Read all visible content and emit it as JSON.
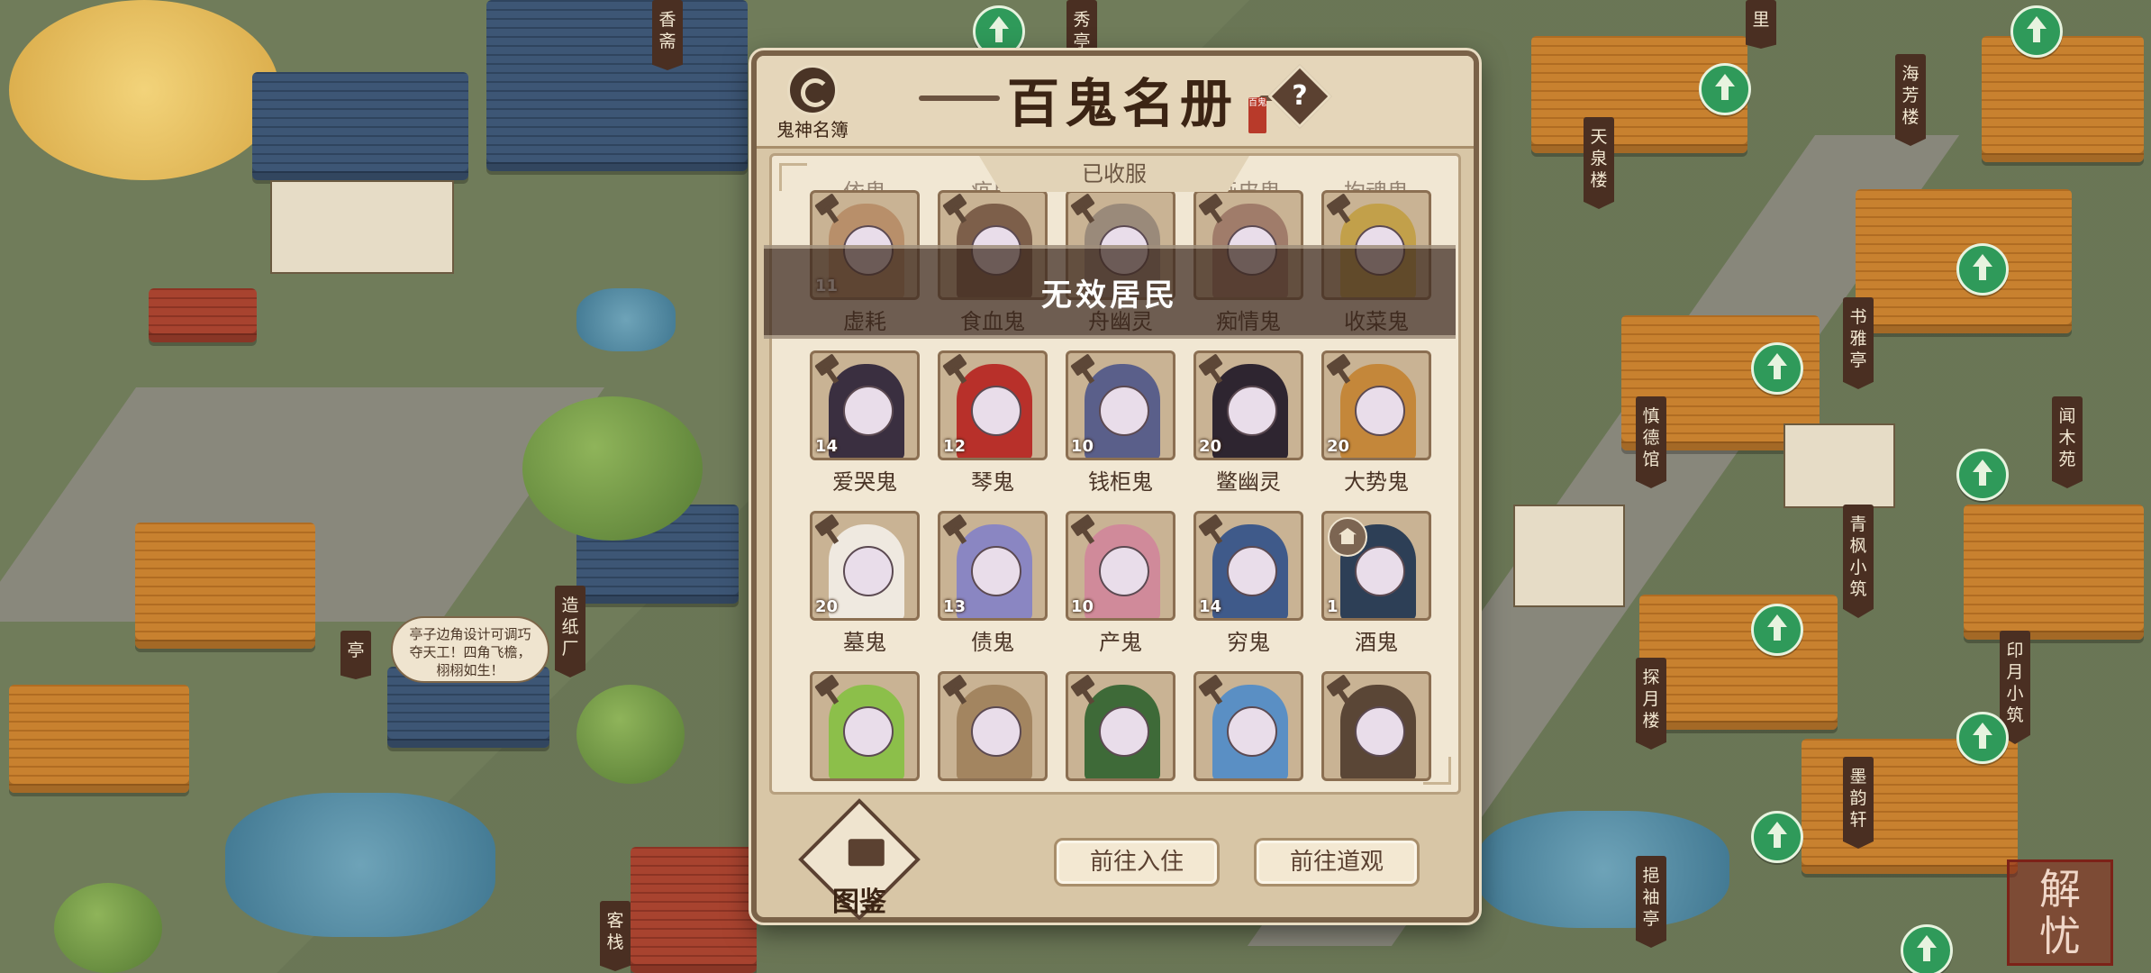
{
  "map": {
    "signposts": [
      {
        "text": "香斋"
      },
      {
        "text": "秀亭"
      },
      {
        "text": "里"
      },
      {
        "text": "天泉楼"
      },
      {
        "text": "海芳楼"
      },
      {
        "text": "书雅亭"
      },
      {
        "text": "闻木苑"
      },
      {
        "text": "慎德馆"
      },
      {
        "text": "青枫小筑"
      },
      {
        "text": "印月小筑"
      },
      {
        "text": "探月楼"
      },
      {
        "text": "墨韵轩"
      },
      {
        "text": "挹袖亭"
      },
      {
        "text": "造纸厂"
      },
      {
        "text": "亭"
      },
      {
        "text": "客栈"
      }
    ],
    "speech_bubble": {
      "line1": "亭子边角设计可调巧",
      "line2": "夺天工！四角飞檐，",
      "line3": "栩栩如生！"
    },
    "corner_seal": {
      "line1": "解",
      "line2": "忧"
    }
  },
  "dialog": {
    "title": "百鬼名册",
    "title_stamp": "百鬼",
    "ghost_book_label": "鬼神名簿",
    "section_tab": "已收服",
    "overlay_message": "无效居民",
    "top_partial_names": [
      "依鬼",
      "疫鬼",
      "庆多",
      "画皮鬼",
      "拘魂鬼"
    ],
    "rows": [
      {
        "cards": [
          {
            "name": "虚耗",
            "level": "11",
            "badge": "hammer",
            "color": "#b88f6a"
          },
          {
            "name": "食血鬼",
            "level": "",
            "badge": "hammer",
            "color": "#7d5f4a"
          },
          {
            "name": "舟幽灵",
            "level": "",
            "badge": "hammer",
            "color": "#9a8a7a"
          },
          {
            "name": "痴情鬼",
            "level": "",
            "badge": "hammer",
            "color": "#a07c6a"
          },
          {
            "name": "收菜鬼",
            "level": "",
            "badge": "hammer",
            "color": "#c2a04a"
          }
        ]
      },
      {
        "cards": [
          {
            "name": "爱哭鬼",
            "level": "14",
            "badge": "hammer",
            "color": "#3a2f40"
          },
          {
            "name": "琴鬼",
            "level": "12",
            "badge": "hammer",
            "color": "#b8302a"
          },
          {
            "name": "钱柜鬼",
            "level": "10",
            "badge": "hammer",
            "color": "#5a5f8a"
          },
          {
            "name": "鳖幽灵",
            "level": "20",
            "badge": "hammer",
            "color": "#2e2530"
          },
          {
            "name": "大势鬼",
            "level": "20",
            "badge": "hammer",
            "color": "#c4873a"
          }
        ]
      },
      {
        "cards": [
          {
            "name": "墓鬼",
            "level": "20",
            "badge": "hammer",
            "color": "#efe9e0"
          },
          {
            "name": "债鬼",
            "level": "13",
            "badge": "hammer",
            "color": "#8a86c2"
          },
          {
            "name": "产鬼",
            "level": "10",
            "badge": "hammer",
            "color": "#d08a9a"
          },
          {
            "name": "穷鬼",
            "level": "14",
            "badge": "hammer",
            "color": "#3f5a8a"
          },
          {
            "name": "酒鬼",
            "level": "1",
            "badge": "temple",
            "color": "#2d3f56"
          }
        ]
      },
      {
        "cards": [
          {
            "name": "",
            "level": "",
            "badge": "hammer",
            "color": "#8cbf4a"
          },
          {
            "name": "",
            "level": "",
            "badge": "hammer",
            "color": "#a38560"
          },
          {
            "name": "",
            "level": "",
            "badge": "hammer",
            "color": "#3e6a38"
          },
          {
            "name": "",
            "level": "",
            "badge": "hammer",
            "color": "#5a8fc4"
          },
          {
            "name": "",
            "level": "",
            "badge": "hammer",
            "color": "#5a4636"
          }
        ]
      }
    ],
    "footer": {
      "tujian_label": "图鉴",
      "move_in_label": "前往入住",
      "temple_label": "前往道观"
    }
  }
}
